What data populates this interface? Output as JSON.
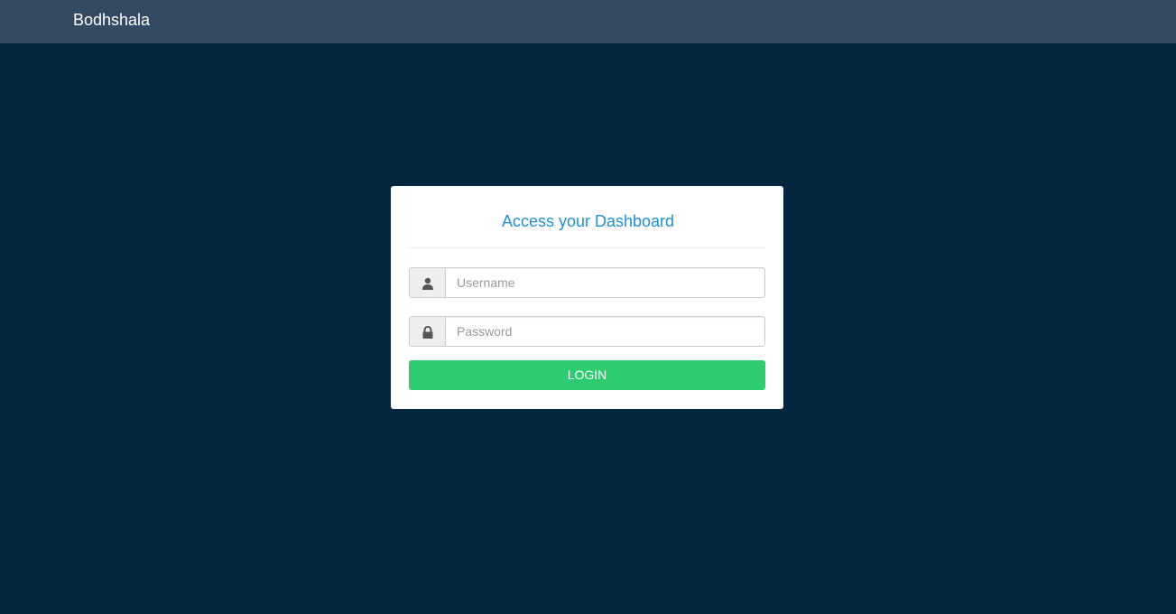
{
  "navbar": {
    "brand": "Bodhshala"
  },
  "login_card": {
    "title": "Access your Dashboard",
    "username": {
      "icon": "user-icon",
      "placeholder": "Username",
      "value": ""
    },
    "password": {
      "icon": "lock-icon",
      "placeholder": "Password",
      "value": ""
    },
    "login_label": "LOGIN"
  },
  "colors": {
    "page_background": "#04273d",
    "navbar_background": "#334a60",
    "title": "#1e90d8",
    "login_button": "#2ecc71"
  }
}
